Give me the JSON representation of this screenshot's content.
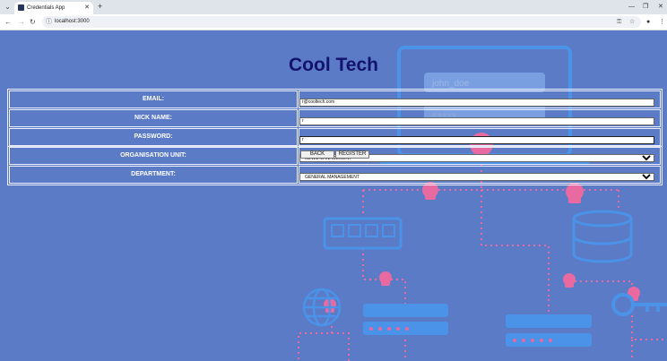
{
  "browser": {
    "tab_title": "Credentials App",
    "url": "localhost:3000"
  },
  "page": {
    "title": "Cool Tech",
    "background_color": "#5b7bc6",
    "title_color": "#13126e",
    "art": {
      "name_field_text": "john_doe",
      "password_mask": "*****"
    },
    "form": {
      "email_label": "EMAIL:",
      "email_value": "r@cooltech.com",
      "nick_label": "NICK NAME:",
      "nick_value": "r",
      "password_label": "PASSWORD:",
      "password_value": "r",
      "org_label": "ORGANISATION UNIT:",
      "org_value": "NEWS MANAGEMENT",
      "dept_label": "DEPARTMENT:",
      "dept_value": "GENERAL MANAGEMENT"
    },
    "buttons": {
      "back": "BACK",
      "register": "REGISTER"
    }
  }
}
